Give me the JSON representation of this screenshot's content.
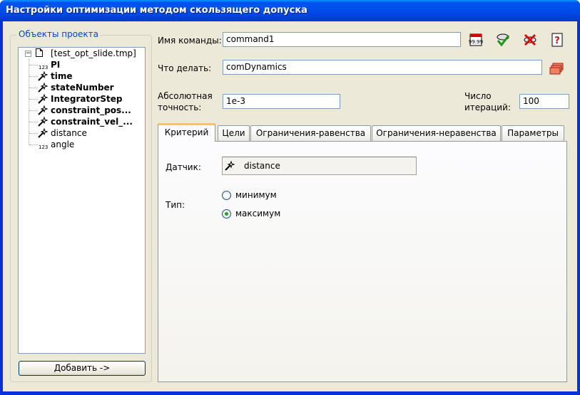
{
  "window": {
    "title": "Настройки оптимизации методом скользящего допуска"
  },
  "project": {
    "legend": "Объекты проекта",
    "root": "[test_opt_slide.tmp]",
    "items": [
      {
        "label": "PI",
        "icon": "number-icon",
        "bold": true
      },
      {
        "label": "time",
        "icon": "wand-icon",
        "bold": true
      },
      {
        "label": "stateNumber",
        "icon": "wand-icon",
        "bold": true
      },
      {
        "label": "IntegratorStep",
        "icon": "wand-icon",
        "bold": true
      },
      {
        "label": "constraint_pos...",
        "icon": "wand-icon",
        "bold": true
      },
      {
        "label": "constraint_vel_...",
        "icon": "wand-icon",
        "bold": true
      },
      {
        "label": "distance",
        "icon": "wand-icon",
        "bold": false
      },
      {
        "label": "angle",
        "icon": "number-icon",
        "bold": false
      }
    ],
    "add_button": "Добавить ->"
  },
  "form": {
    "command_label": "Имя команды:",
    "command_value": "command1",
    "action_label": "Что делать:",
    "action_value": "comDynamics",
    "accuracy_label_1": "Абсолютная",
    "accuracy_label_2": "точность:",
    "accuracy_value": "1e-3",
    "iterations_label_1": "Число",
    "iterations_label_2": "итераций:",
    "iterations_value": "100"
  },
  "tabs": [
    "Критерий",
    "Цели",
    "Ограничения-равенства",
    "Ограничения-неравенства",
    "Параметры"
  ],
  "criterion": {
    "sensor_label": "Датчик:",
    "sensor_value": "distance",
    "type_label": "Тип:",
    "options": [
      "минимум",
      "максимум"
    ],
    "selected": "максимум"
  },
  "colors": {
    "title_bar": "#0053ee",
    "tab_active_accent": "#ffc83c",
    "group_legend": "#0046d5"
  }
}
